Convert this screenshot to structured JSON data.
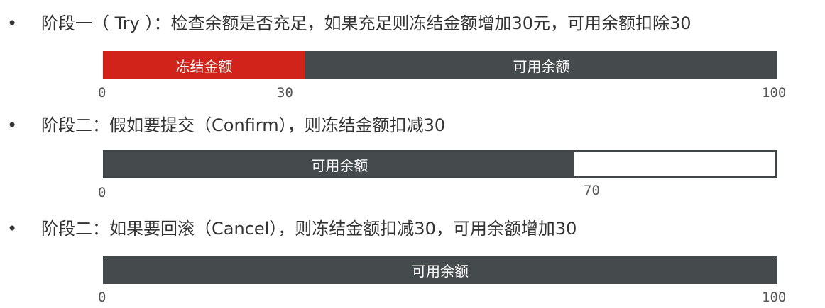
{
  "bullet_symbol": "•",
  "stage1": {
    "text": "阶段一（ Try ）：检查余额是否充足，如果充足则冻结金额增加30元，可用余额扣除30",
    "bar": {
      "frozen_label": "冻结金额",
      "available_label": "可用余额",
      "frozen_fraction": 0.3,
      "available_fraction": 0.7,
      "colors": {
        "frozen": "#d1231a",
        "available": "#454a4c"
      }
    },
    "ticks": [
      "0",
      "30",
      "100"
    ]
  },
  "stage2": {
    "text": "阶段二：假如要提交（Confirm），则冻结金额扣减30",
    "bar": {
      "available_label": "可用余额",
      "available_fraction": 0.7,
      "empty_fraction": 0.3,
      "colors": {
        "available": "#454a4c",
        "empty": "#ffffff"
      }
    },
    "ticks": [
      "0",
      "70"
    ]
  },
  "stage3": {
    "text": "阶段二：如果要回滚（Cancel），则冻结金额扣减30，可用余额增加30",
    "bar": {
      "available_label": "可用余额",
      "available_fraction": 1.0,
      "colors": {
        "available": "#454a4c"
      }
    },
    "ticks": [
      "0",
      "100"
    ]
  }
}
